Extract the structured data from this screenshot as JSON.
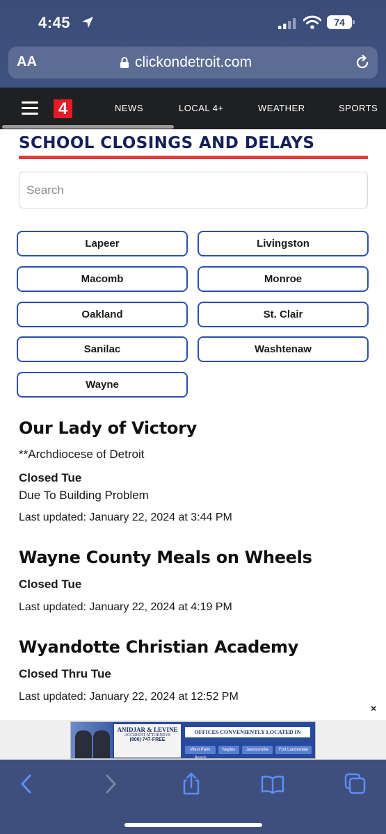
{
  "status_bar": {
    "time": "4:45",
    "battery": "74"
  },
  "browser": {
    "text_size_label": "AA",
    "url": "clickondetroit.com"
  },
  "site_nav": {
    "logo": "4",
    "links": [
      "NEWS",
      "LOCAL 4+",
      "WEATHER",
      "SPORTS"
    ]
  },
  "page": {
    "title": "SCHOOL CLOSINGS AND DELAYS",
    "search_placeholder": "Search",
    "counties": [
      "Lapeer",
      "Livingston",
      "Macomb",
      "Monroe",
      "Oakland",
      "St. Clair",
      "Sanilac",
      "Washtenaw",
      "Wayne"
    ]
  },
  "closings": [
    {
      "name": "Our Lady of Victory",
      "subtitle": "**Archdiocese of Detroit",
      "status": "Closed Tue",
      "reason": "Due To Building Problem",
      "updated": "Last updated: January 22, 2024 at 3:44 PM"
    },
    {
      "name": "Wayne County Meals on Wheels",
      "status": "Closed Tue",
      "updated": "Last updated: January 22, 2024 at 4:19 PM"
    },
    {
      "name": "Wyandotte Christian Academy",
      "status": "Closed Thru Tue",
      "updated": "Last updated: January 22, 2024 at 12:52 PM"
    }
  ],
  "ad": {
    "close": "×",
    "firm": "ANIDJAR & LEVINE",
    "firm_subtitle": "ACCIDENT ATTORNEYS",
    "phone": "(800) 747-FREE",
    "offices": "OFFICES CONVENIENTLY LOCATED IN",
    "cities": [
      "West Palm Beach",
      "Naples",
      "Jacksonville",
      "Fort Lauderdale"
    ]
  },
  "toolbar_icons": [
    "back-icon",
    "forward-icon",
    "share-icon",
    "bookmarks-icon",
    "tabs-icon"
  ]
}
